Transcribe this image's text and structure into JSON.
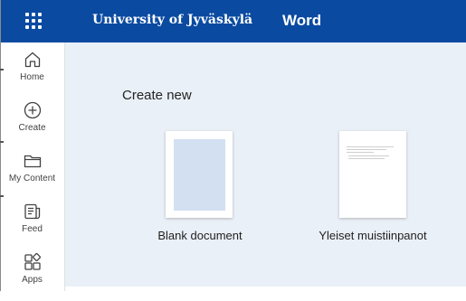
{
  "header": {
    "waffle_icon": "app-launcher-icon",
    "org_name": "University of Jyväskylä",
    "app_name": "Word",
    "bg_color": "#0a4aa1"
  },
  "rail": {
    "items": [
      {
        "label": "Home",
        "icon": "home-icon"
      },
      {
        "label": "Create",
        "icon": "create-icon"
      },
      {
        "label": "My Content",
        "icon": "folder-icon"
      },
      {
        "label": "Feed",
        "icon": "feed-icon"
      },
      {
        "label": "Apps",
        "icon": "apps-icon"
      }
    ]
  },
  "main": {
    "section_title": "Create new",
    "templates": [
      {
        "label": "Blank document",
        "thumb": "blank"
      },
      {
        "label": "Yleiset muistiinpanot",
        "thumb": "notes"
      }
    ],
    "bg_color": "#eaf0f7"
  }
}
